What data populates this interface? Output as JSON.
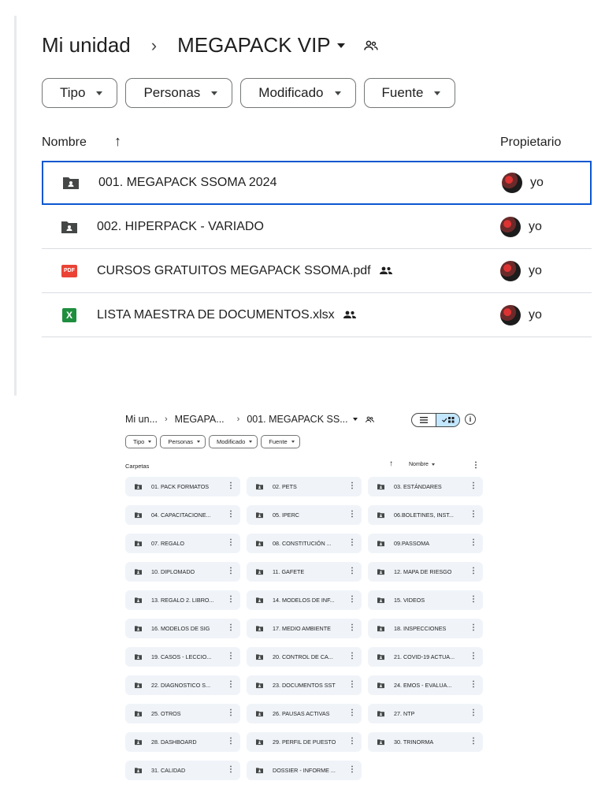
{
  "top": {
    "breadcrumb": {
      "root": "Mi unidad",
      "current": "MEGAPACK VIP"
    },
    "filters": [
      "Tipo",
      "Personas",
      "Modificado",
      "Fuente"
    ],
    "columns": {
      "name": "Nombre",
      "owner": "Propietario"
    },
    "rows": [
      {
        "type": "folder",
        "name": "001. MEGAPACK SSOMA 2024",
        "shared": false,
        "owner": "yo",
        "selected": true
      },
      {
        "type": "folder",
        "name": "002. HIPERPACK - VARIADO",
        "shared": false,
        "owner": "yo",
        "selected": false
      },
      {
        "type": "pdf",
        "badge": "PDF",
        "name": "CURSOS GRATUITOS MEGAPACK SSOMA.pdf",
        "shared": true,
        "owner": "yo",
        "selected": false
      },
      {
        "type": "xlsx",
        "badge": "X",
        "name": "LISTA MAESTRA DE DOCUMENTOS.xlsx",
        "shared": true,
        "owner": "yo",
        "selected": false
      }
    ]
  },
  "bottom": {
    "breadcrumb": {
      "root": "Mi un...",
      "middle": "MEGAPA...",
      "current": "001. MEGAPACK SS..."
    },
    "filters": [
      "Tipo",
      "Personas",
      "Modificado",
      "Fuente"
    ],
    "section_label": "Carpetas",
    "sort_label": "Nombre",
    "folders": [
      "01. PACK FORMATOS",
      "02. PETS",
      "03. ESTÁNDARES",
      "04. CAPACITACIONE...",
      "05. IPERC",
      "06.BOLETINES, INST...",
      "07. REGALO",
      "08. CONSTITUCIÓN ...",
      "09.PASSOMA",
      "10. DIPLOMADO",
      "11. GAFETE",
      "12. MAPA DE RIESGO",
      "13. REGALO 2. LIBRO...",
      "14. MODELOS DE INF...",
      "15. VIDEOS",
      "16. MODELOS DE SIG",
      "17. MEDIO AMBIENTE",
      "18. INSPECCIONES",
      "19. CASOS - LECCIO...",
      "20. CONTROL DE CA...",
      "21. COVID-19 ACTUA...",
      "22. DIAGNOSTICO S...",
      "23. DOCUMENTOS SST",
      "24. EMOS - EVALUA...",
      "25. OTROS",
      "26. PAUSAS ACTIVAS",
      "27. NTP",
      "28. DASHBOARD",
      "29. PERFIL DE PUESTO",
      "30. TRINORMA",
      "31. CALIDAD",
      "DOSSIER - INFORME ..."
    ]
  },
  "icons": {
    "folder": "shared-folder-icon",
    "shared": "people-icon",
    "more": "more-vert-icon",
    "sort_up": "arrow-up-icon",
    "list_view": "list-view-icon",
    "grid_view": "grid-view-icon",
    "info": "info-icon"
  },
  "colors": {
    "accent": "#0b57d0",
    "tile_bg": "#f0f4f9",
    "pdf": "#ea4335",
    "xlsx": "#1e8e3e",
    "toggle_active": "#c2e7ff"
  }
}
